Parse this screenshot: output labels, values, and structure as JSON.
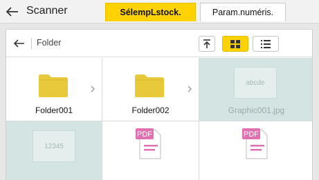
{
  "header": {
    "title": "Scanner",
    "tab_select_storage": "SélempLstock.",
    "tab_scan_settings": "Param.numéris."
  },
  "toolbar": {
    "path_label": "Folder"
  },
  "items": [
    {
      "label": "Folder001",
      "type": "folder",
      "enabled": true
    },
    {
      "label": "Folder002",
      "type": "folder",
      "enabled": true
    },
    {
      "label": "Graphic001.jpg",
      "type": "image",
      "thumb_text": "abcde",
      "enabled": false
    },
    {
      "label": "",
      "type": "image",
      "thumb_text": "12345",
      "enabled": false
    },
    {
      "label": "",
      "type": "pdf",
      "badge": "PDF",
      "enabled": true
    },
    {
      "label": "",
      "type": "pdf",
      "badge": "PDF",
      "enabled": true
    }
  ],
  "colors": {
    "accent": "#ffd200",
    "folder": "#e8c93a",
    "pdf_badge": "#e070b0",
    "disabled_bg": "#d4e4e2"
  },
  "icons": [
    "back-arrow-icon",
    "scroll-to-top-icon",
    "thumbnail-view-icon",
    "list-view-icon",
    "folder-icon",
    "chevron-right-icon",
    "pdf-file-icon"
  ]
}
